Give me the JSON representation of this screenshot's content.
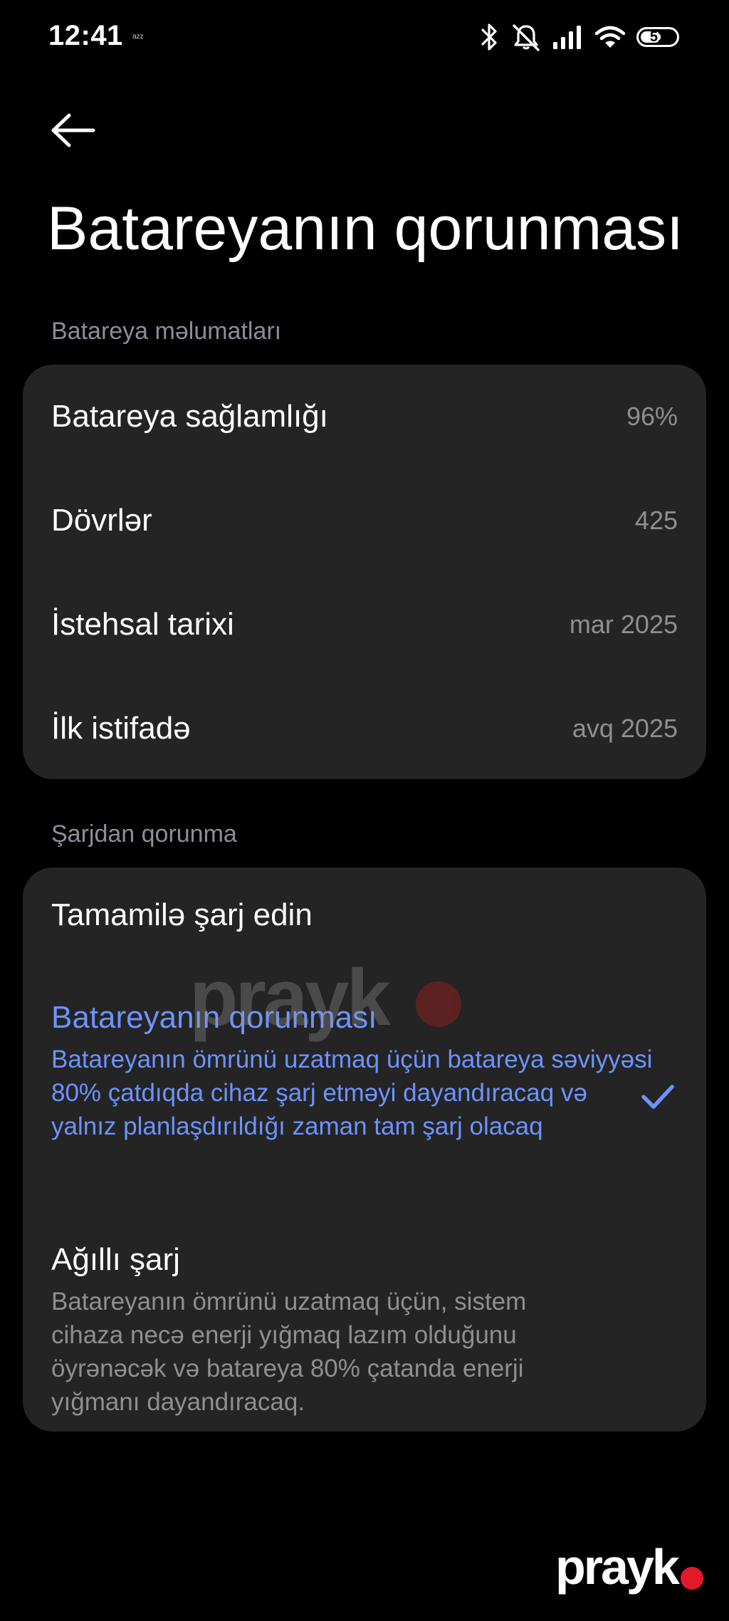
{
  "status_bar": {
    "time": "12:41",
    "carrier": "azz",
    "battery_level": "51",
    "icons": [
      "bluetooth-icon",
      "bell-off-icon",
      "signal-icon",
      "wifi-icon",
      "battery-icon"
    ]
  },
  "header": {
    "back_icon": "arrow-left-icon",
    "title": "Batareyanın qorunması"
  },
  "battery_info": {
    "section_title": "Batareya məlumatları",
    "rows": [
      {
        "label": "Batareya sağlamlığı",
        "value": "96%"
      },
      {
        "label": "Dövrlər",
        "value": "425"
      },
      {
        "label": "İstehsal tarixi",
        "value": "mar 2025"
      },
      {
        "label": "İlk istifadə",
        "value": "avq 2025"
      }
    ]
  },
  "charge_protection": {
    "section_title": "Şarjdan qorunma",
    "options": [
      {
        "title": "Tamamilə şarj edin",
        "description": "",
        "selected": false
      },
      {
        "title": "Batareyanın qorunması",
        "description": "Batareyanın ömrünü uzatmaq üçün batareya səviyyəsi 80% çatdıqda cihaz şarj etməyi dayandıracaq və yalnız planlaşdırıldığı zaman tam şarj olacaq",
        "selected": true
      },
      {
        "title": "Ağıllı şarj",
        "description": "Batareyanın ömrünü uzatmaq üçün, sistem cihaza necə enerji yığmaq lazım olduğunu öyrənəcək və batareya 80% çatanda enerji yığmanı dayandıracaq.",
        "selected": false
      }
    ]
  },
  "watermark": {
    "text": "prayk",
    "logo_text": "prayk"
  },
  "colors": {
    "background": "#000000",
    "card": "#242424",
    "accent": "#6d93ff",
    "secondary_text": "#8f8f8f",
    "section_header": "#8d8d9a",
    "brand_dot": "#e3192b"
  }
}
